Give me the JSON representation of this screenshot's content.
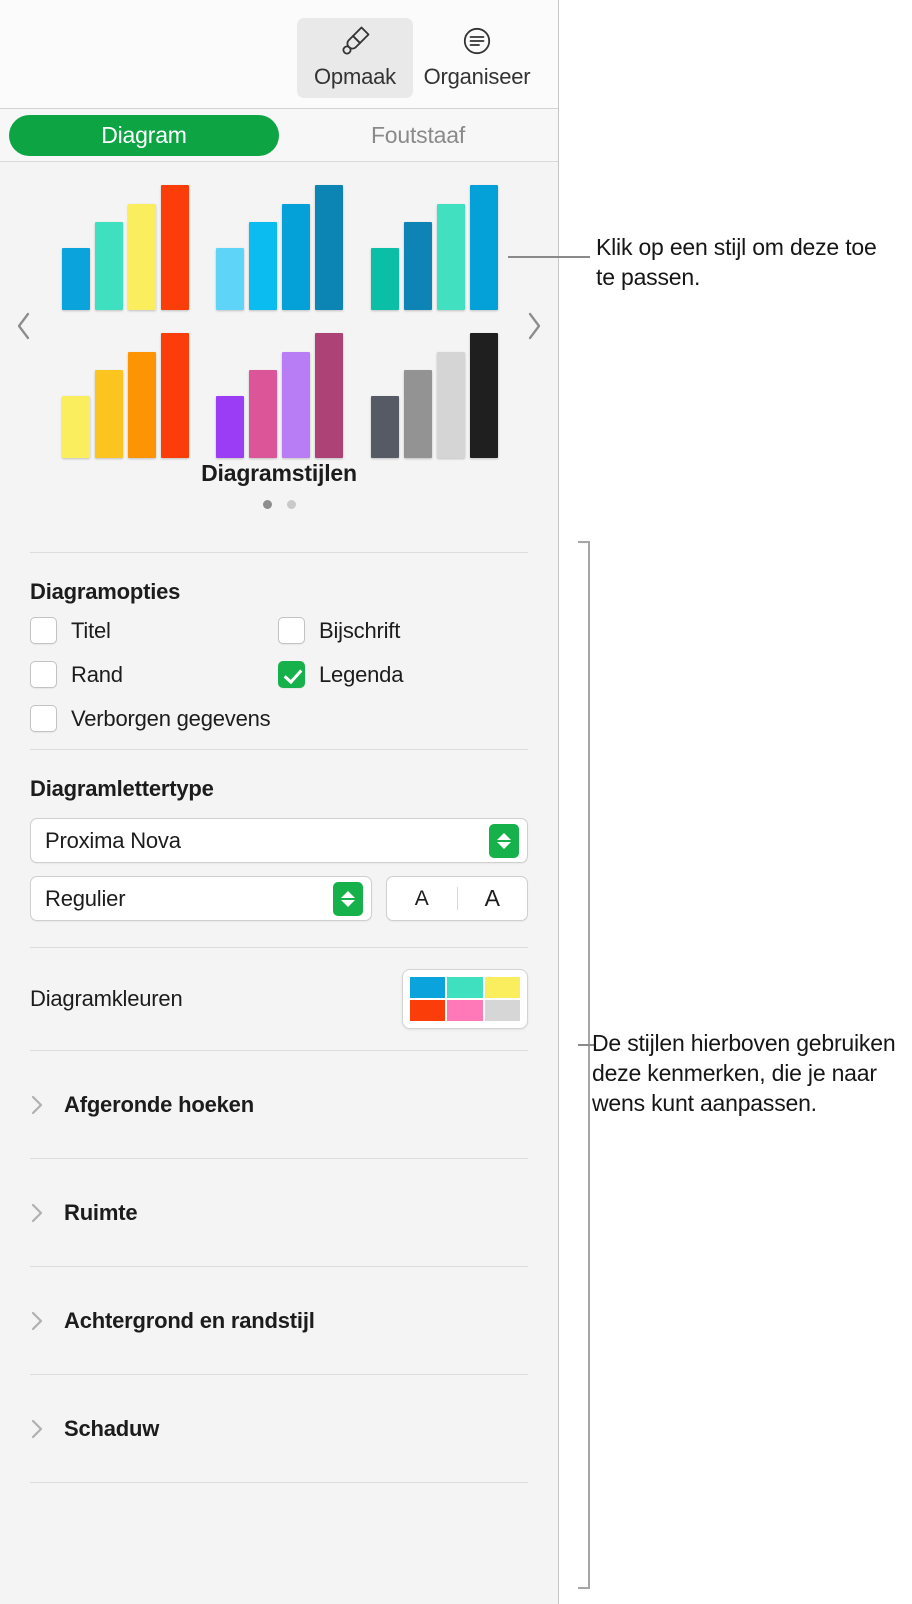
{
  "toolbar": {
    "items": [
      {
        "label": "Opmaak",
        "icon": "paintbrush-icon",
        "active": true
      },
      {
        "label": "Organiseer",
        "icon": "organize-icon",
        "active": false
      }
    ]
  },
  "tabs": [
    {
      "label": "Diagram",
      "selected": true
    },
    {
      "label": "Foutstaaf",
      "selected": false
    }
  ],
  "style_picker": {
    "title": "Diagramstijlen",
    "prev_icon": "chevron-left-icon",
    "next_icon": "chevron-right-icon",
    "page_dots": [
      {
        "active": true
      },
      {
        "active": false
      }
    ],
    "styles": [
      {
        "name": "style-1",
        "colors": [
          "#0BA3DC",
          "#3FE0C0",
          "#FBEE5E",
          "#FB3D0A"
        ],
        "heights": [
          62,
          88,
          106,
          125
        ]
      },
      {
        "name": "style-2",
        "colors": [
          "#5FD4F9",
          "#0BBCF0",
          "#04A0D8",
          "#0C84B4"
        ],
        "heights": [
          62,
          88,
          106,
          125
        ]
      },
      {
        "name": "style-3",
        "colors": [
          "#0BBFA6",
          "#0E83B5",
          "#40E0C0",
          "#04A0D8"
        ],
        "heights": [
          62,
          88,
          106,
          125
        ]
      },
      {
        "name": "style-4",
        "colors": [
          "#FBEE5E",
          "#FCC41E",
          "#FC9403",
          "#FB3D0A"
        ],
        "heights": [
          62,
          88,
          106,
          125
        ]
      },
      {
        "name": "style-5",
        "colors": [
          "#9B3DF5",
          "#DB5598",
          "#B87DF5",
          "#AD4277"
        ],
        "heights": [
          62,
          88,
          106,
          125
        ]
      },
      {
        "name": "style-6",
        "colors": [
          "#555A64",
          "#939393",
          "#D5D5D5",
          "#1F1F1F"
        ],
        "heights": [
          62,
          88,
          106,
          125
        ]
      }
    ]
  },
  "chart_options": {
    "title": "Diagramopties",
    "items": [
      {
        "label": "Titel",
        "checked": false
      },
      {
        "label": "Bijschrift",
        "checked": false
      },
      {
        "label": "Rand",
        "checked": false
      },
      {
        "label": "Legenda",
        "checked": true
      },
      {
        "label": "Verborgen gegevens",
        "checked": false
      }
    ]
  },
  "chart_font": {
    "title": "Diagramlettertype",
    "family_value": "Proxima Nova",
    "style_value": "Regulier",
    "size_decrease_label": "A",
    "size_increase_label": "A"
  },
  "chart_colors": {
    "label": "Diagramkleuren",
    "swatches": [
      "#0BA3DC",
      "#3FE0C0",
      "#FBEE5E",
      "#FB3D0A",
      "#FF79B8",
      "#D6D6D6"
    ]
  },
  "sections": [
    {
      "label": "Afgeronde hoeken",
      "icon": "chevron-right-icon",
      "expanded": false
    },
    {
      "label": "Ruimte",
      "icon": "chevron-right-icon",
      "expanded": false
    },
    {
      "label": "Achtergrond en randstijl",
      "icon": "chevron-right-icon",
      "expanded": false
    },
    {
      "label": "Schaduw",
      "icon": "chevron-right-icon",
      "expanded": false
    }
  ],
  "callouts": [
    {
      "text": "Klik op een stijl om deze toe te passen."
    },
    {
      "text": "De stijlen hierboven gebruiken deze kenmerken, die je naar wens kunt aanpassen."
    }
  ],
  "colors": {
    "accent_green": "#17b14b",
    "tab_green": "#0da544",
    "panel_bg": "#f4f4f4"
  }
}
